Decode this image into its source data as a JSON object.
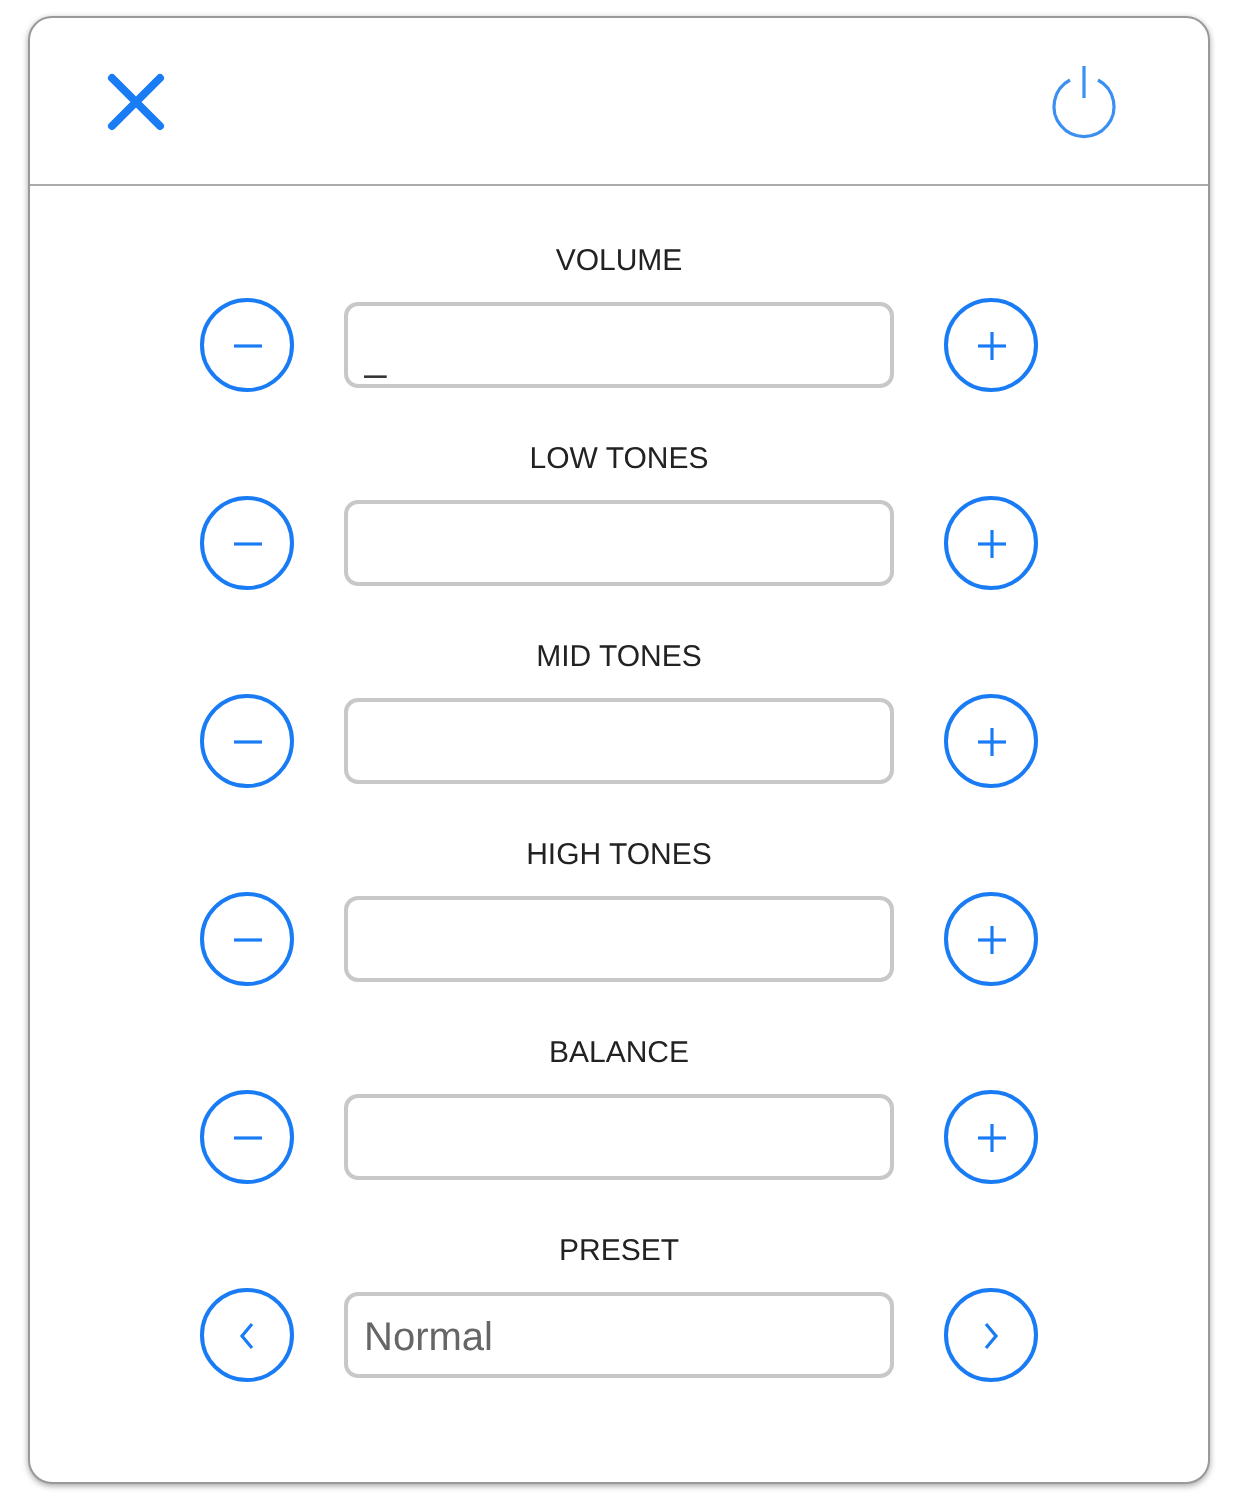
{
  "controls": [
    {
      "kind": "stepper",
      "label": "VOLUME",
      "value": "_"
    },
    {
      "kind": "stepper",
      "label": "LOW TONES"
    },
    {
      "kind": "stepper",
      "label": "MID TONES"
    },
    {
      "kind": "stepper",
      "label": "HIGH TONES"
    },
    {
      "kind": "stepper",
      "label": "BALANCE"
    },
    {
      "kind": "selector",
      "label": "PRESET",
      "value": "Normal"
    }
  ]
}
